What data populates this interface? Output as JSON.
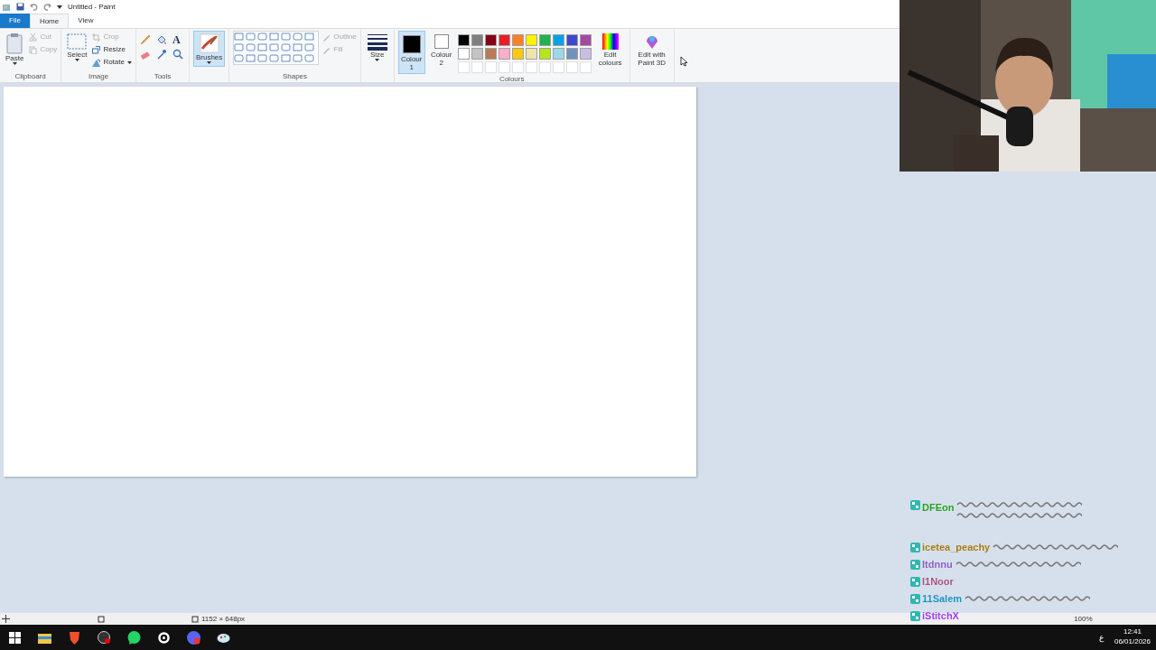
{
  "window": {
    "title": "Untitled - Paint"
  },
  "tabs": [
    {
      "label": "File",
      "selected": false,
      "kind": "file"
    },
    {
      "label": "Home",
      "selected": true,
      "kind": "tab"
    },
    {
      "label": "View",
      "selected": false,
      "kind": "tab"
    }
  ],
  "clipboard": {
    "label": "Clipboard",
    "paste": "Paste",
    "items": [
      {
        "label": "Cut",
        "disabled": true
      },
      {
        "label": "Copy",
        "disabled": true
      }
    ]
  },
  "image": {
    "label": "Image",
    "select": "Select",
    "items": [
      {
        "label": "Crop",
        "disabled": true
      },
      {
        "label": "Resize",
        "disabled": false
      },
      {
        "label": "Rotate",
        "disabled": false
      }
    ]
  },
  "tools": {
    "label": "Tools",
    "text_tool": "A"
  },
  "brushes": {
    "label": "Brushes",
    "selected": true
  },
  "shapes": {
    "label": "Shapes",
    "items": [
      {
        "label": "Outline",
        "disabled": true
      },
      {
        "label": "Fill",
        "disabled": true
      }
    ]
  },
  "size": {
    "label": "Size"
  },
  "colours": {
    "label": "Colours",
    "slots": [
      {
        "label": "Colour 1",
        "color": "#000000",
        "selected": true
      },
      {
        "label": "Colour 2",
        "color": "#ffffff",
        "selected": false
      }
    ],
    "palette": [
      {
        "color": "#000000"
      },
      {
        "color": "#7f7f7f"
      },
      {
        "color": "#880015"
      },
      {
        "color": "#ed1c24"
      },
      {
        "color": "#ff7f27"
      },
      {
        "color": "#fff200"
      },
      {
        "color": "#22b14c"
      },
      {
        "color": "#00a2e8"
      },
      {
        "color": "#3f48cc"
      },
      {
        "color": "#a349a4"
      },
      {
        "color": "#ffffff"
      },
      {
        "color": "#c3c3c3"
      },
      {
        "color": "#b97a57"
      },
      {
        "color": "#ffaec9"
      },
      {
        "color": "#ffc90e"
      },
      {
        "color": "#efe4b0"
      },
      {
        "color": "#b5e61d"
      },
      {
        "color": "#99d9ea"
      },
      {
        "color": "#7092be"
      },
      {
        "color": "#c8bfe7"
      }
    ],
    "edit": "Edit colours"
  },
  "paint3d": {
    "label": "Edit with Paint 3D"
  },
  "status_bar": {
    "size": "1152 × 648px",
    "zoom": "100%"
  },
  "chat": [
    {
      "user": "DFEon",
      "color": "#1f9e1f",
      "kind": "wrapped"
    },
    {
      "user": "icetea_peachy",
      "color": "#a07810",
      "kind": "inline"
    },
    {
      "user": "Itdnnu",
      "color": "#8a5cc4",
      "kind": "inline"
    },
    {
      "user": "I1Noor",
      "color": "#a8507f",
      "kind": "plain"
    },
    {
      "user": "11Salem",
      "color": "#1a8fc0",
      "kind": "inline"
    },
    {
      "user": "iStitchX",
      "color": "#9b3cf0",
      "kind": "plain"
    }
  ],
  "clock": {
    "time": "12:41",
    "date": "06/01/2026",
    "language": "ع"
  }
}
